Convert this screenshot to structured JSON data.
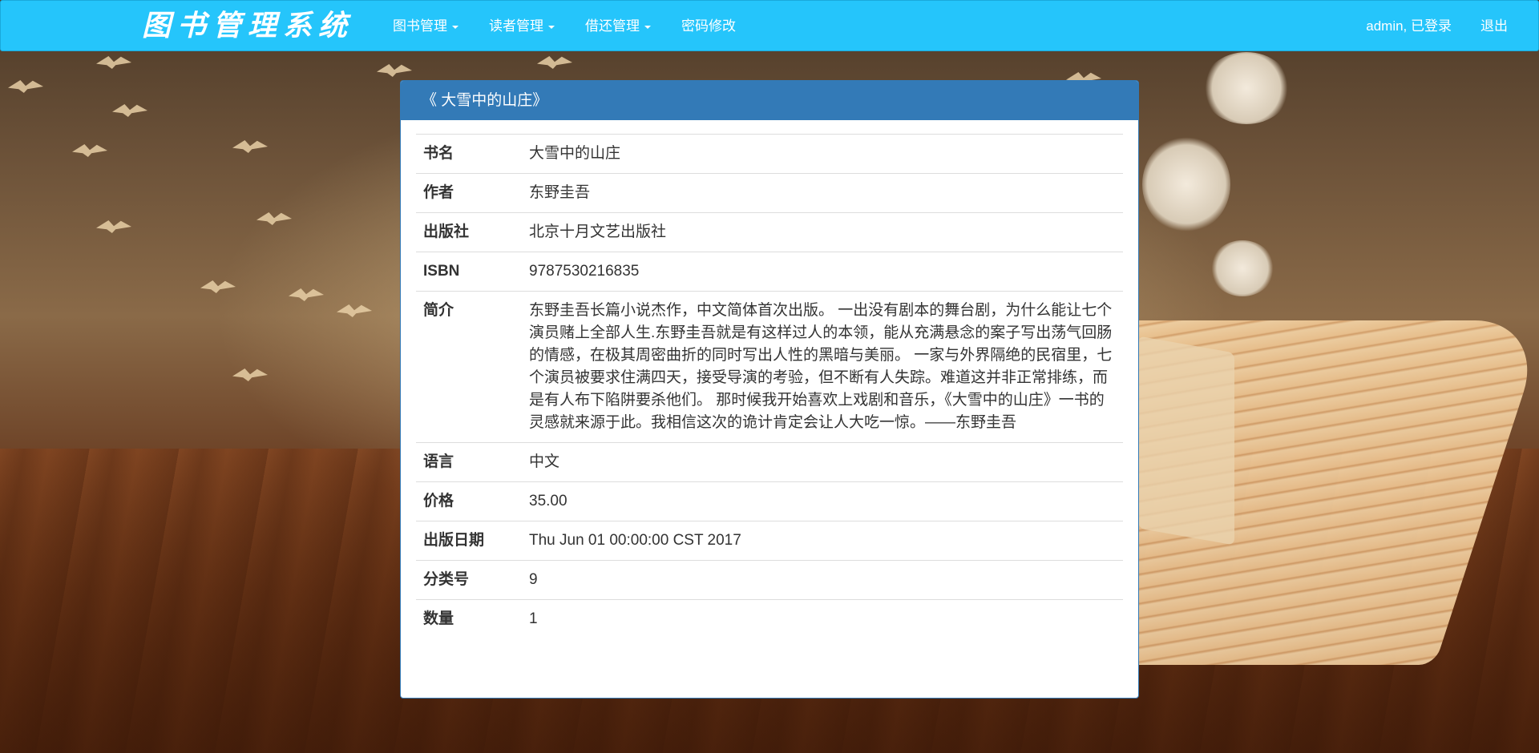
{
  "navbar": {
    "brand": "图书管理系统",
    "menu": [
      {
        "label": "图书管理",
        "has_dropdown": true
      },
      {
        "label": "读者管理",
        "has_dropdown": true
      },
      {
        "label": "借还管理",
        "has_dropdown": true
      },
      {
        "label": "密码修改",
        "has_dropdown": false
      }
    ],
    "user_status": "admin, 已登录",
    "logout": "退出",
    "colors": {
      "background": "#25c5fb",
      "text": "#ffffff"
    }
  },
  "panel": {
    "title": "《 大雪中的山庄》",
    "colors": {
      "heading": "#337ab7"
    },
    "rows": [
      {
        "label": "书名",
        "value": "大雪中的山庄"
      },
      {
        "label": "作者",
        "value": "东野圭吾"
      },
      {
        "label": "出版社",
        "value": "北京十月文艺出版社"
      },
      {
        "label": "ISBN",
        "value": "9787530216835"
      },
      {
        "label": "简介",
        "value": "东野圭吾长篇小说杰作，中文简体首次出版。 一出没有剧本的舞台剧，为什么能让七个演员赌上全部人生.东野圭吾就是有这样过人的本领，能从充满悬念的案子写出荡气回肠的情感，在极其周密曲折的同时写出人性的黑暗与美丽。 一家与外界隔绝的民宿里，七个演员被要求住满四天，接受导演的考验，但不断有人失踪。难道这并非正常排练，而是有人布下陷阱要杀他们。 那时候我开始喜欢上戏剧和音乐，《大雪中的山庄》一书的灵感就来源于此。我相信这次的诡计肯定会让人大吃一惊。——东野圭吾"
      },
      {
        "label": "语言",
        "value": "中文"
      },
      {
        "label": "价格",
        "value": "35.00"
      },
      {
        "label": "出版日期",
        "value": "Thu Jun 01 00:00:00 CST 2017"
      },
      {
        "label": "分类号",
        "value": "9"
      },
      {
        "label": "数量",
        "value": "1"
      }
    ]
  }
}
